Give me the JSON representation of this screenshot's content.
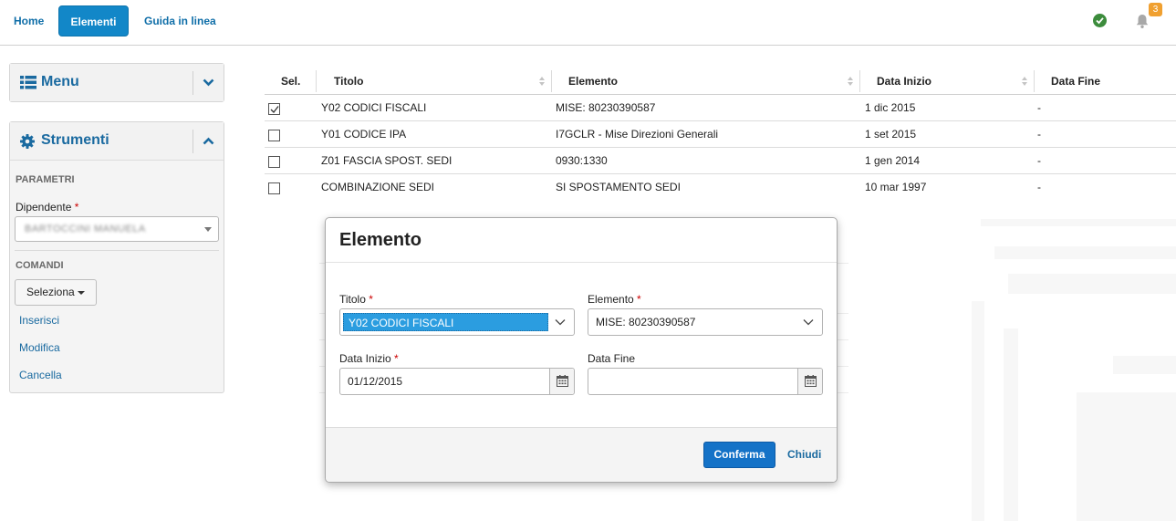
{
  "nav": {
    "home": "Home",
    "elementi": "Elementi",
    "guida": "Guida in linea",
    "notification_count": "3"
  },
  "menu_panel": {
    "title": "Menu"
  },
  "tools_panel": {
    "title": "Strumenti",
    "parametri_label": "PARAMETRI",
    "dipendente_label": "Dipendente",
    "required_mark": "*",
    "dipendente_value": "BARTOCCINI MANUELA",
    "comandi_label": "COMANDI",
    "seleziona_label": "Seleziona",
    "links": [
      "Inserisci",
      "Modifica",
      "Cancella"
    ]
  },
  "table": {
    "headers": [
      "Sel.",
      "Titolo",
      "Elemento",
      "Data Inizio",
      "Data Fine"
    ],
    "rows": [
      {
        "checked": true,
        "titolo": "Y02 CODICI FISCALI",
        "elemento": "MISE: 80230390587",
        "inizio": "1 dic 2015",
        "fine": "-"
      },
      {
        "checked": false,
        "titolo": "Y01 CODICE IPA",
        "elemento": "I7GCLR - Mise Direzioni Generali",
        "inizio": "1 set 2015",
        "fine": "-"
      },
      {
        "checked": false,
        "titolo": "Z01 FASCIA SPOST. SEDI",
        "elemento": "0930:1330",
        "inizio": "1 gen 2014",
        "fine": "-"
      },
      {
        "checked": false,
        "titolo": "COMBINAZIONE SEDI",
        "elemento": "SI SPOSTAMENTO SEDI",
        "inizio": "10 mar 1997",
        "fine": "-"
      }
    ]
  },
  "modal": {
    "title": "Elemento",
    "titolo_label": "Titolo",
    "titolo_value": "Y02 CODICI FISCALI",
    "elemento_label": "Elemento",
    "elemento_value": "MISE: 80230390587",
    "data_inizio_label": "Data Inizio",
    "data_inizio_value": "01/12/2015",
    "data_fine_label": "Data Fine",
    "data_fine_value": "",
    "confirm_label": "Conferma",
    "close_label": "Chiudi",
    "required_mark": "*"
  },
  "colors": {
    "accent": "#1287c8",
    "link": "#1a6aa0",
    "required": "#cc0000",
    "selection": "#2b9de0",
    "status_ok": "#3c8c3c",
    "badge": "#f0a030"
  },
  "icons": [
    "list-icon",
    "gear-icon",
    "chevron-down-icon",
    "chevron-up-icon",
    "check-circle-icon",
    "bell-icon",
    "calendar-icon"
  ]
}
